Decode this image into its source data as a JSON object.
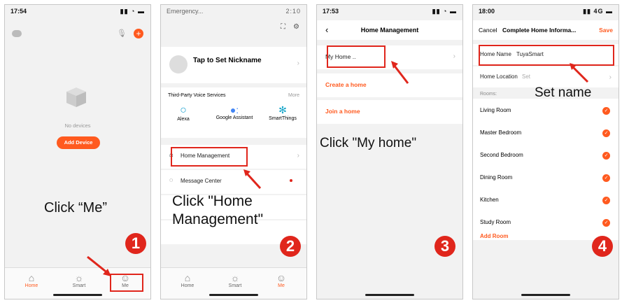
{
  "colors": {
    "accent": "#ff5a1f",
    "annotation": "#e0261c"
  },
  "panel1": {
    "time": "17:54",
    "empty_text": "No devices",
    "add_device": "Add Device",
    "tabs": [
      {
        "label": "Home",
        "icon": "home-icon"
      },
      {
        "label": "Smart",
        "icon": "sun-icon"
      },
      {
        "label": "Me",
        "icon": "user-icon"
      }
    ],
    "caption": "Click “Me”",
    "step": "1"
  },
  "panel2": {
    "status": "Emergency...",
    "status_right": "2:10",
    "nickname": "Tap to Set Nickname",
    "section": "Third-Party Voice Services",
    "more": "More",
    "services": [
      {
        "label": "Alexa",
        "icon": "alexa-icon"
      },
      {
        "label": "Google Assistant",
        "icon": "google-assistant-icon"
      },
      {
        "label": "SmartThings",
        "icon": "smartthings-icon"
      }
    ],
    "home_management": "Home Management",
    "message_center": "Message Center",
    "tabs": [
      {
        "label": "Home"
      },
      {
        "label": "Smart"
      },
      {
        "label": "Me"
      }
    ],
    "caption_line1": "Click \"Home",
    "caption_line2": "Management\"",
    "step": "2"
  },
  "panel3": {
    "time": "17:53",
    "title": "Home Management",
    "my_home": "My Home ..",
    "create": "Create a home",
    "join": "Join a home",
    "caption": "Click \"My home\"",
    "step": "3"
  },
  "panel4": {
    "time": "18:00",
    "cancel": "Cancel",
    "title": "Complete Home Informa...",
    "save": "Save",
    "home_name_label": "Home Name",
    "home_name_value": "TuyaSmart",
    "home_location_label": "Home Location",
    "home_location_value": "Set",
    "rooms_label": "Rooms:",
    "rooms": [
      "Living Room",
      "Master Bedroom",
      "Second Bedroom",
      "Dining Room",
      "Kitchen",
      "Study Room"
    ],
    "add_room": "Add Room",
    "caption": "Set name",
    "step": "4"
  }
}
